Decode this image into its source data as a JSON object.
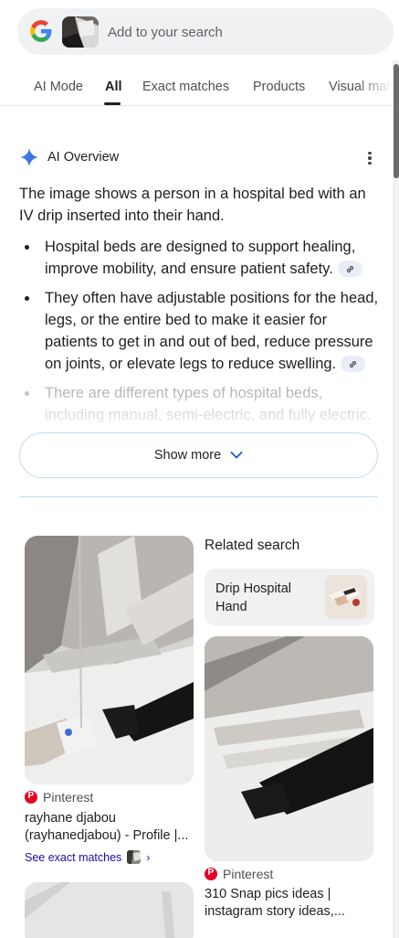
{
  "search": {
    "placeholder": "Add to your search"
  },
  "tabs": [
    {
      "label": "AI Mode"
    },
    {
      "label": "All"
    },
    {
      "label": "Exact matches"
    },
    {
      "label": "Products"
    },
    {
      "label": "Visual matches"
    }
  ],
  "active_tab": "All",
  "ai_overview": {
    "title": "AI Overview",
    "intro": "The image shows a person in a hospital bed with an IV drip inserted into their hand.",
    "bullets": [
      "Hospital beds are designed to support healing, improve mobility, and ensure patient safety.",
      "They often have adjustable positions for the head, legs, or the entire bed to make it easier for patients to get in and out of bed, reduce pressure on joints, or elevate legs to reduce swelling.",
      "There are different types of hospital beds, including manual, semi-electric, and fully electric."
    ],
    "show_more": "Show more"
  },
  "results": {
    "left": {
      "source": "Pinterest",
      "title": "rayhane djabou (rayhanedjabou) - Profile |...",
      "exact_link": "See exact matches"
    },
    "related": {
      "heading": "Related search",
      "chip_label": "Drip Hospital Hand"
    },
    "right": {
      "source": "Pinterest",
      "title": "310 Snap pics ideas | instagram story ideas,..."
    }
  },
  "colors": {
    "accent_blue": "#1a0dab",
    "pinterest_red": "#e60023",
    "chip_bg": "#eff1f3"
  }
}
